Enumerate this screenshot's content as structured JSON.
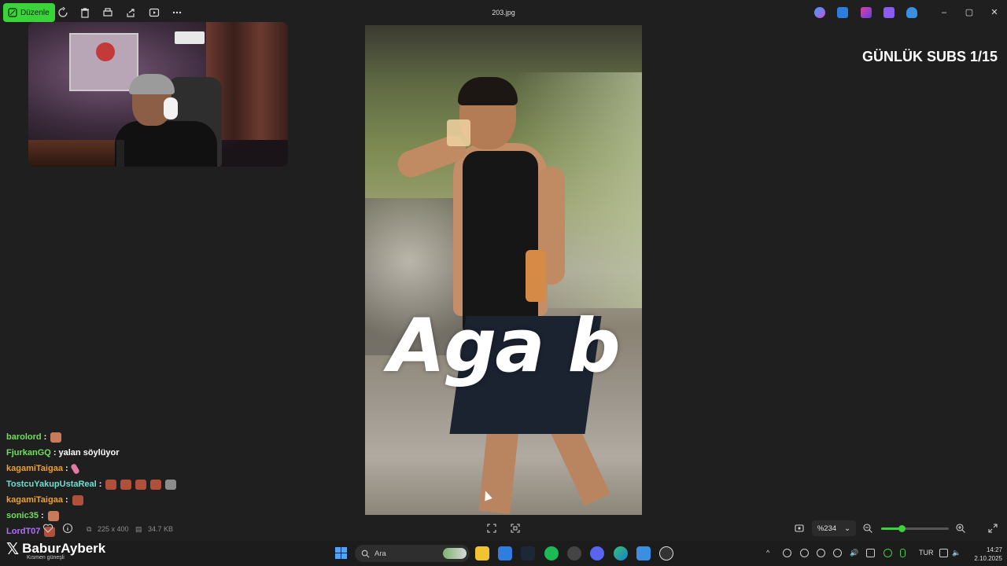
{
  "toolbar": {
    "edit_label": "Düzenle",
    "file_title": "203.jpg"
  },
  "overlay": {
    "subs_counter": "GÜNLÜK SUBS 1/15"
  },
  "image": {
    "caption": "Aga b",
    "dimensions": "225 x 400",
    "file_size": "34.7 KB"
  },
  "zoom": {
    "label": "%234",
    "level_fraction": 0.3
  },
  "chat": {
    "messages": [
      {
        "user": "barolord",
        "separator": ":",
        "text": "",
        "user_color": "#6ee05a"
      },
      {
        "user": "FjurkanGQ",
        "separator": ":",
        "text": "yalan söylüyor",
        "user_color": "#6ee05a"
      },
      {
        "user": "kagamiTaigaa",
        "separator": ":",
        "text": "",
        "user_color": "#f0a030"
      },
      {
        "user": "TostcuYakupUstaReal",
        "separator": ":",
        "text": "",
        "user_color": "#6ee0d0"
      },
      {
        "user": "kagamiTaigaa",
        "separator": ":",
        "text": "",
        "user_color": "#f0a030"
      },
      {
        "user": "sonic35",
        "separator": ":",
        "text": "",
        "user_color": "#6ee05a"
      },
      {
        "user": "LordT07",
        "separator": "",
        "text": "",
        "user_color": "#b070ff"
      }
    ]
  },
  "branding": {
    "x_logo": "𝕏",
    "name": "BaburAyberk",
    "weather_text": "Kısmen güneşli"
  },
  "taskbar": {
    "search_label": "Ara",
    "language": "TUR",
    "time": "14:27",
    "date": "2.10.2025"
  },
  "colors": {
    "accent": "#3ad33a",
    "background": "#1f1f1f"
  }
}
